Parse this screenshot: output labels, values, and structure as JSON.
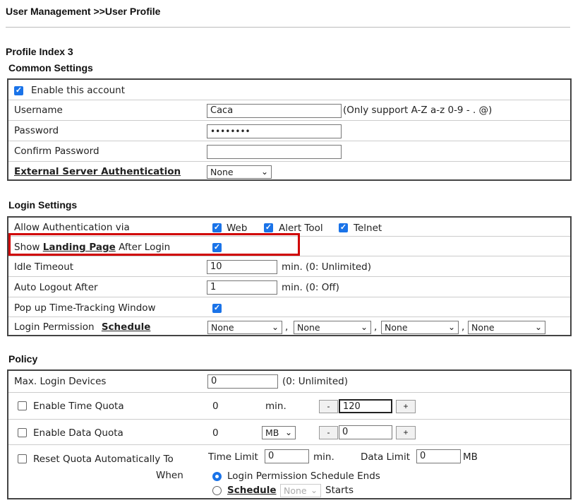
{
  "breadcrumb": "User Management >>User Profile",
  "profile_index": "Profile Index 3",
  "common": {
    "title": "Common Settings",
    "enable_label": "Enable this account",
    "username_label": "Username",
    "username_value": "Caca",
    "username_hint": "(Only support A-Z a-z 0-9 - . @)",
    "password_label": "Password",
    "password_value": "••••••••",
    "confirm_label": "Confirm Password",
    "confirm_value": "",
    "ext_auth_label": "External Server Authentication",
    "ext_auth_value": "None"
  },
  "login": {
    "title": "Login Settings",
    "allow_label": "Allow Authentication via",
    "web_label": "Web",
    "alert_label": "Alert Tool",
    "telnet_label": "Telnet",
    "landing_pre": "Show",
    "landing_link": "Landing Page",
    "landing_post": "After Login",
    "idle_label": "Idle Timeout",
    "idle_value": "10",
    "idle_hint": "min. (0: Unlimited)",
    "auto_label": "Auto Logout After",
    "auto_value": "1",
    "auto_hint": "min. (0: Off)",
    "popup_label": "Pop up Time-Tracking Window",
    "perm_label": "Login Permission",
    "perm_link": "Schedule",
    "perm_values": [
      "None",
      "None",
      "None",
      "None"
    ],
    "comma": ","
  },
  "policy": {
    "title": "Policy",
    "max_label": "Max. Login Devices",
    "max_value": "0",
    "max_hint": "(0: Unlimited)",
    "time_label": "Enable Time Quota",
    "time_value": "0",
    "time_unit": "min.",
    "time_input": "120",
    "data_label": "Enable Data Quota",
    "data_value": "0",
    "data_unit": "MB",
    "data_input": "0",
    "minus": "-",
    "plus": "+",
    "reset_label": "Reset Quota Automatically To",
    "when_label": "When",
    "time_limit_label": "Time Limit",
    "time_limit_value": "0",
    "time_limit_unit": "min.",
    "data_limit_label": "Data Limit",
    "data_limit_value": "0",
    "data_limit_unit": "MB",
    "radio1_label": "Login Permission Schedule Ends",
    "radio2_link": "Schedule",
    "radio2_select": "None",
    "radio2_post": "Starts"
  }
}
